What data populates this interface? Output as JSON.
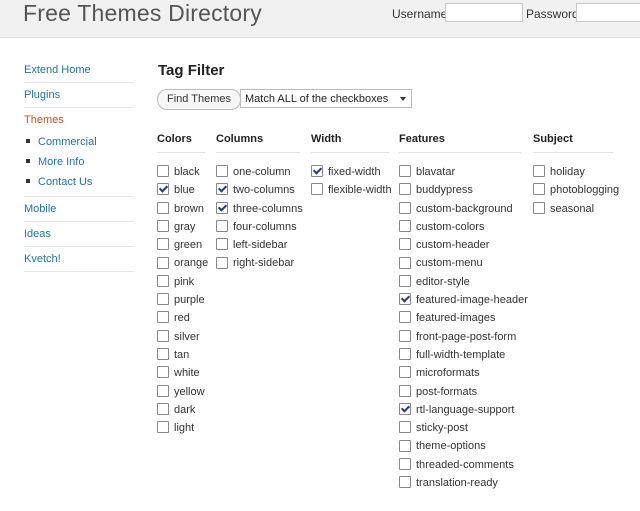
{
  "header": {
    "site_title": "Free Themes Directory",
    "username_label": "Username",
    "password_label": "Password",
    "username_value": "",
    "password_value": ""
  },
  "nav": {
    "items_top": [
      "Extend Home",
      "Plugins"
    ],
    "current": "Themes",
    "sub_items": [
      "Commercial",
      "More Info",
      "Contact Us"
    ],
    "items_bottom": [
      "Mobile",
      "Ideas",
      "Kvetch!"
    ]
  },
  "filter": {
    "title": "Tag Filter",
    "find_button": "Find Themes",
    "match_select": "Match ALL of the checkboxes"
  },
  "columns": [
    {
      "heading": "Colors",
      "options": [
        {
          "label": "black",
          "checked": false
        },
        {
          "label": "blue",
          "checked": true
        },
        {
          "label": "brown",
          "checked": false
        },
        {
          "label": "gray",
          "checked": false
        },
        {
          "label": "green",
          "checked": false
        },
        {
          "label": "orange",
          "checked": false
        },
        {
          "label": "pink",
          "checked": false
        },
        {
          "label": "purple",
          "checked": false
        },
        {
          "label": "red",
          "checked": false
        },
        {
          "label": "silver",
          "checked": false
        },
        {
          "label": "tan",
          "checked": false
        },
        {
          "label": "white",
          "checked": false
        },
        {
          "label": "yellow",
          "checked": false
        },
        {
          "label": "dark",
          "checked": false
        },
        {
          "label": "light",
          "checked": false
        }
      ]
    },
    {
      "heading": "Columns",
      "options": [
        {
          "label": "one-column",
          "checked": false
        },
        {
          "label": "two-columns",
          "checked": true
        },
        {
          "label": "three-columns",
          "checked": true
        },
        {
          "label": "four-columns",
          "checked": false
        },
        {
          "label": "left-sidebar",
          "checked": false
        },
        {
          "label": "right-sidebar",
          "checked": false
        }
      ]
    },
    {
      "heading": "Width",
      "options": [
        {
          "label": "fixed-width",
          "checked": true
        },
        {
          "label": "flexible-width",
          "checked": false
        }
      ]
    },
    {
      "heading": "Features",
      "options": [
        {
          "label": "blavatar",
          "checked": false
        },
        {
          "label": "buddypress",
          "checked": false
        },
        {
          "label": "custom-background",
          "checked": false
        },
        {
          "label": "custom-colors",
          "checked": false
        },
        {
          "label": "custom-header",
          "checked": false
        },
        {
          "label": "custom-menu",
          "checked": false
        },
        {
          "label": "editor-style",
          "checked": false
        },
        {
          "label": "featured-image-header",
          "checked": true
        },
        {
          "label": "featured-images",
          "checked": false
        },
        {
          "label": "front-page-post-form",
          "checked": false
        },
        {
          "label": "full-width-template",
          "checked": false
        },
        {
          "label": "microformats",
          "checked": false
        },
        {
          "label": "post-formats",
          "checked": false
        },
        {
          "label": "rtl-language-support",
          "checked": true
        },
        {
          "label": "sticky-post",
          "checked": false
        },
        {
          "label": "theme-options",
          "checked": false
        },
        {
          "label": "threaded-comments",
          "checked": false
        },
        {
          "label": "translation-ready",
          "checked": false
        }
      ]
    },
    {
      "heading": "Subject",
      "options": [
        {
          "label": "holiday",
          "checked": false
        },
        {
          "label": "photoblogging",
          "checked": false
        },
        {
          "label": "seasonal",
          "checked": false
        }
      ]
    }
  ],
  "colors": {
    "link": "#21759b",
    "current": "#d54e21",
    "header_bg": "#f1f1f1"
  }
}
